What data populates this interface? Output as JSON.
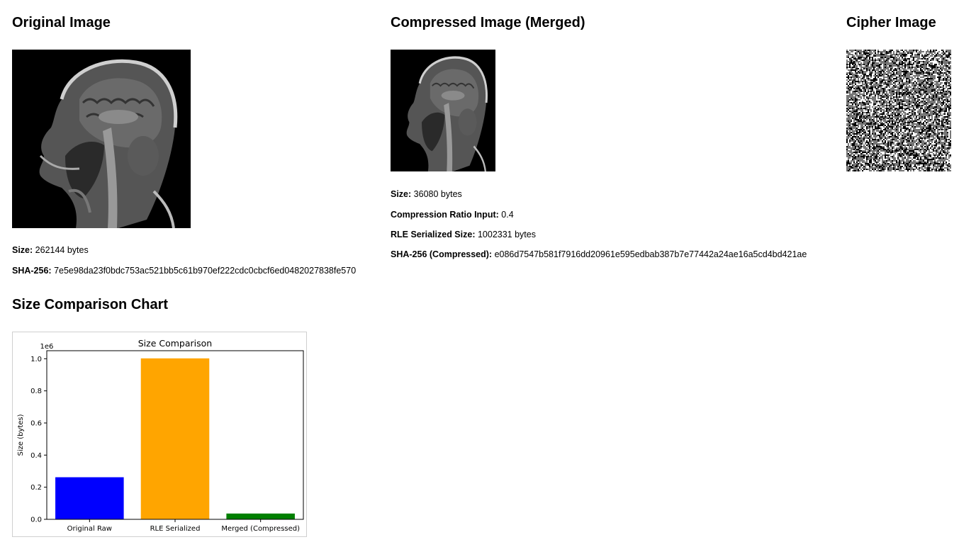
{
  "original": {
    "title": "Original Image",
    "size_label": "Size:",
    "size_value": "262144 bytes",
    "sha_label": "SHA-256:",
    "sha_value": "7e5e98da23f0bdc753ac521bb5c61b970ef222cdc0cbcf6ed0482027838fe570"
  },
  "compressed": {
    "title": "Compressed Image (Merged)",
    "size_label": "Size:",
    "size_value": "36080 bytes",
    "ratio_label": "Compression Ratio Input:",
    "ratio_value": "0.4",
    "rle_label": "RLE Serialized Size:",
    "rle_value": "1002331 bytes",
    "sha_label": "SHA-256 (Compressed):",
    "sha_value": "e086d7547b581f7916dd20961e595edbab387b7e77442a24ae16a5cd4bd421ae"
  },
  "cipher": {
    "title": "Cipher Image"
  },
  "chart_section": {
    "title": "Size Comparison Chart"
  },
  "chart_data": {
    "type": "bar",
    "title": "Size Comparison",
    "xlabel": "",
    "ylabel": "Size (bytes)",
    "scale_note": "1e6",
    "categories": [
      "Original Raw",
      "RLE Serialized",
      "Merged (Compressed)"
    ],
    "values": [
      262144,
      1002331,
      36080
    ],
    "colors": [
      "#0000ff",
      "#ffa500",
      "#008000"
    ],
    "ylim": [
      0,
      1050000
    ],
    "yticks": [
      0,
      200000,
      400000,
      600000,
      800000,
      1000000
    ],
    "ytick_labels": [
      "0.0",
      "0.2",
      "0.4",
      "0.6",
      "0.8",
      "1.0"
    ],
    "grid": false,
    "legend": "none"
  }
}
